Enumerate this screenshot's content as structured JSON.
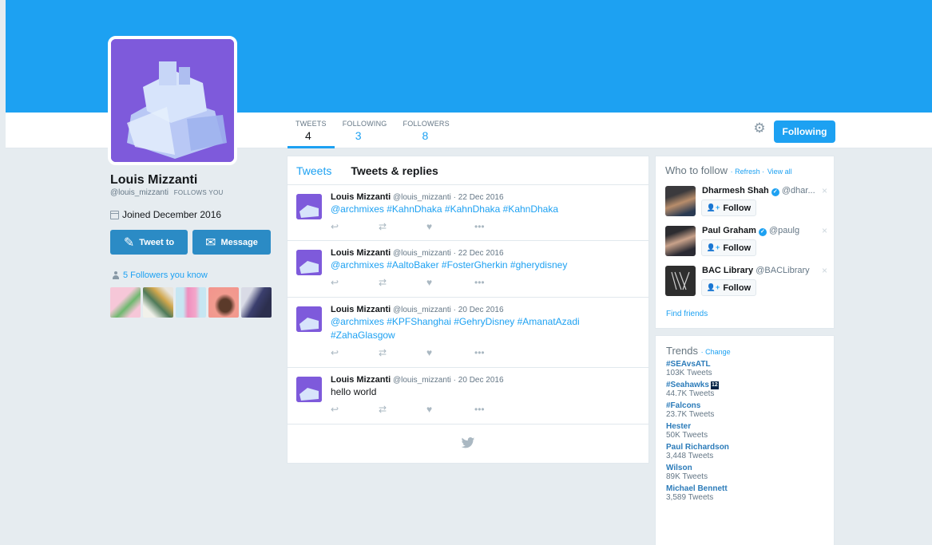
{
  "profile": {
    "name": "Louis Mizzanti",
    "handle": "@louis_mizzanti",
    "follows_you": "FOLLOWS YOU",
    "joined": "Joined December 2016",
    "tweet_to": "Tweet to",
    "message": "Message",
    "followers_you_know": "5 Followers you know"
  },
  "stats": [
    {
      "label": "TWEETS",
      "value": "4"
    },
    {
      "label": "FOLLOWING",
      "value": "3"
    },
    {
      "label": "FOLLOWERS",
      "value": "8"
    }
  ],
  "header": {
    "following_button": "Following",
    "settings_icon": "gear-icon"
  },
  "timeline": {
    "tabs": [
      "Tweets",
      "Tweets & replies"
    ],
    "tweets": [
      {
        "name": "Louis Mizzanti",
        "meta": "@louis_mizzanti · 22 Dec 2016",
        "text": "@archmixes #KahnDhaka #KahnDhaka #KahnDhaka"
      },
      {
        "name": "Louis Mizzanti",
        "meta": "@louis_mizzanti · 22 Dec 2016",
        "text": "@archmixes #AaltoBaker #FosterGherkin #gherydisney"
      },
      {
        "name": "Louis Mizzanti",
        "meta": "@louis_mizzanti · 20 Dec 2016",
        "text": "@archmixes #KPFShanghai #GehryDisney #AmanatAzadi #ZahaGlasgow"
      },
      {
        "name": "Louis Mizzanti",
        "meta": "@louis_mizzanti · 20 Dec 2016",
        "text": "hello world"
      }
    ]
  },
  "who_to_follow": {
    "title": "Who to follow",
    "refresh": "· Refresh ·",
    "view_all": "View all",
    "follow_label": "Follow",
    "find_friends": "Find friends",
    "suggestions": [
      {
        "name": "Dharmesh Shah",
        "handle": "@dhar..."
      },
      {
        "name": "Paul Graham",
        "handle": "@paulg"
      },
      {
        "name": "BAC Library",
        "handle": "@BACLibrary"
      }
    ]
  },
  "trends": {
    "title": "Trends",
    "change": "· Change",
    "items": [
      {
        "name": "#SEAvsATL",
        "count": "103K Tweets"
      },
      {
        "name": "#Seahawks",
        "badge": "12",
        "count": "44.7K Tweets"
      },
      {
        "name": "#Falcons",
        "count": "23.7K Tweets"
      },
      {
        "name": "Hester",
        "count": "50K Tweets"
      },
      {
        "name": "Paul Richardson",
        "count": "3,448 Tweets"
      },
      {
        "name": "Wilson",
        "count": "89K Tweets"
      },
      {
        "name": "Michael Bennett",
        "count": "3,589 Tweets"
      }
    ]
  },
  "colors": {
    "brand": "#1da1f2",
    "button": "#2b8bc5",
    "background": "#e6ecf0"
  }
}
